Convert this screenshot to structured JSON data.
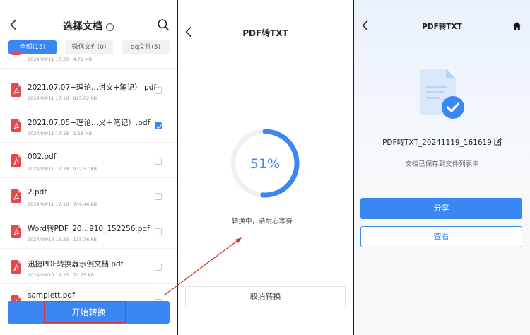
{
  "colors": {
    "accent": "#3a86f3",
    "pdf_red": "#e5484d",
    "annotation_red": "#d9333f"
  },
  "select_screen": {
    "title": "选择文档",
    "tabs": [
      {
        "label": "全部(15)",
        "active": true
      },
      {
        "label": "微信文件(0)",
        "active": false
      },
      {
        "label": "qq文件(5)",
        "active": false
      }
    ],
    "partial_item_meta": "2024/09/11 17:20 |   4.71 MB",
    "files": [
      {
        "name": "2021.07.07+理论…讲义+笔记）.pdf",
        "meta": "2024/09/11 17:18 |   825.82 KB",
        "checked": false
      },
      {
        "name": "2021.07.05+理论…义＋笔记）.pdf",
        "meta": "2024/09/11 17:18 |   1.18 MB",
        "checked": true
      },
      {
        "name": "002.pdf",
        "meta": "2024/09/11 17:18 |   932.57 KB",
        "checked": false
      },
      {
        "name": "2.pdf",
        "meta": "2024/09/11 17:18 |   749.46 KB",
        "checked": false
      },
      {
        "name": "Word转PDF_20…910_152256.pdf",
        "meta": "2024/09/10 15:23 |   115.76 KB",
        "checked": false
      },
      {
        "name": "迅捷PDF转换器示例文档.pdf",
        "meta": "2024/09/10 14:15 |   72.95 KB",
        "checked": false
      },
      {
        "name": "samplett.pdf",
        "meta": "",
        "checked": false
      }
    ],
    "start_button": "开始转换"
  },
  "progress_screen": {
    "title": "PDF转TXT",
    "progress_label": "51%",
    "progress_fraction": 0.51,
    "status": "转换中，请耐心等待…",
    "cancel_button": "取消转换"
  },
  "result_screen": {
    "title": "PDF转TXT",
    "file_name": "PDF转TXT_20241119_161619",
    "saved_message": "文档已保存到文件列表中",
    "share_button": "分享",
    "view_button": "查看"
  }
}
